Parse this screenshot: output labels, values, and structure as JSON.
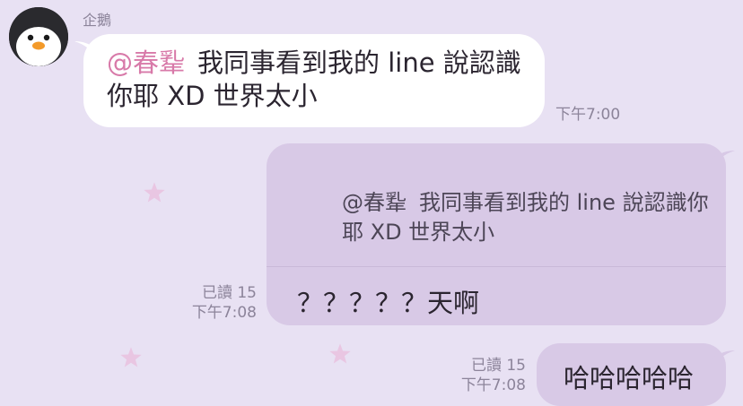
{
  "colors": {
    "background": "#e8e1f3",
    "incoming_bubble": "#ffffff",
    "outgoing_bubble": "#d8c9e6",
    "mention": "#d87aa9",
    "meta_text": "#8c849a",
    "star": "#e9c6e2"
  },
  "incoming_message": {
    "sender": "企鵝",
    "avatar_icon": "penguin-icon",
    "mention": "@春𢆡",
    "text": "我同事看到我的 line 說認識你耶 XD 世界太小",
    "time": "下午7:00"
  },
  "reply_message": {
    "quoted_mention": "@春𢆡",
    "quoted_text": "我同事看到我的 line 說認識你耶 XD 世界太小",
    "text": "？？？？？天啊",
    "read_status": "已讀 15",
    "time": "下午7:08"
  },
  "last_message": {
    "text": "哈哈哈哈哈",
    "read_status": "已讀 15",
    "time": "下午7:08"
  }
}
